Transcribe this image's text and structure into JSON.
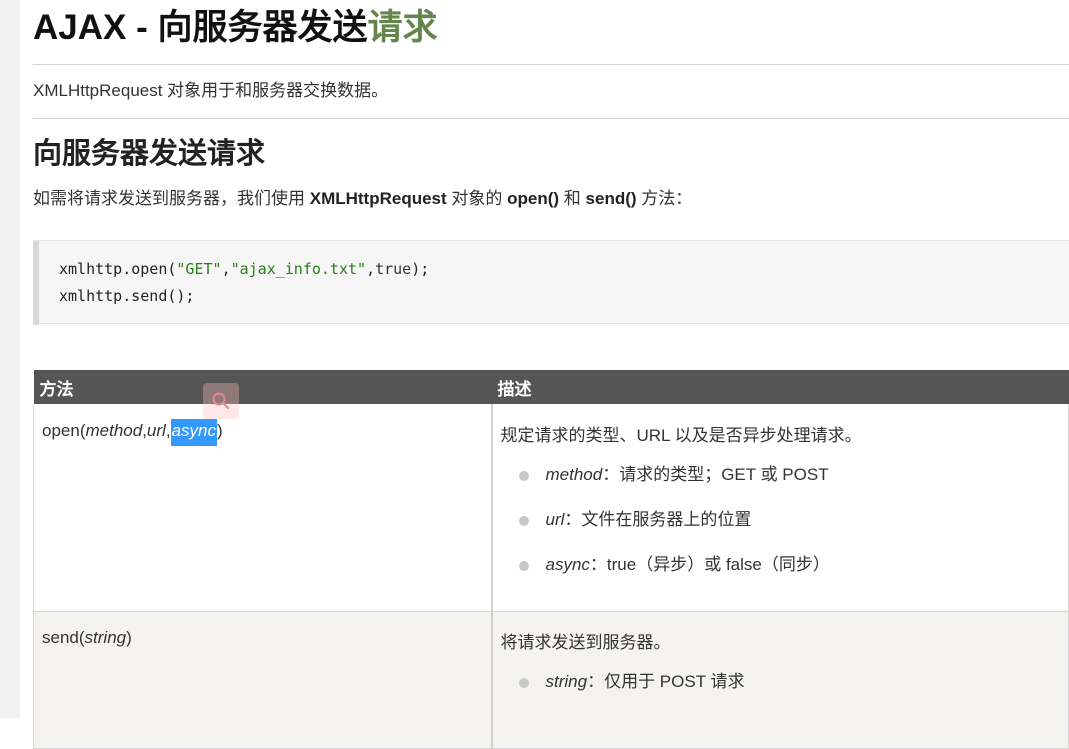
{
  "page": {
    "title_main": "AJAX - 向服务器发送",
    "title_accent": "请求",
    "intro": "XMLHttpRequest 对象用于和服务器交换数据。",
    "section_title": "向服务器发送请求",
    "desc_prefix": "如需将请求发送到服务器，我们使用 ",
    "desc_bold1": "XMLHttpRequest",
    "desc_mid1": " 对象的 ",
    "desc_bold2": "open()",
    "desc_mid2": " 和 ",
    "desc_bold3": "send()",
    "desc_suffix": " 方法："
  },
  "code": {
    "line1_a": "xmlhttp.open(",
    "line1_s1": "\"GET\"",
    "line1_c1": ",",
    "line1_s2": "\"ajax_info.txt\"",
    "line1_c2": ",",
    "line1_kw": "true",
    "line1_end": ");",
    "line2": "xmlhttp.send();"
  },
  "table": {
    "headers": [
      "方法",
      "描述"
    ],
    "rows": [
      {
        "method_prefix": "open(",
        "method_p1": "method",
        "method_sep1": ",",
        "method_p2": "url",
        "method_sep2": ",",
        "method_p3_selected": "async",
        "method_suffix": ")",
        "description": "规定请求的类型、URL 以及是否异步处理请求。",
        "params": [
          {
            "name": "method",
            "text": "：请求的类型；GET 或 POST"
          },
          {
            "name": "url",
            "text": "：文件在服务器上的位置"
          },
          {
            "name": "async",
            "text": "：true（异步）或 false（同步）"
          }
        ]
      },
      {
        "method_prefix": "send(",
        "method_p1": "string",
        "method_suffix": ")",
        "description": "将请求发送到服务器。",
        "params": [
          {
            "name": "string",
            "text": "：仅用于 POST 请求"
          }
        ]
      }
    ]
  },
  "colors": {
    "accent": "#64854c",
    "header_bg": "#555555",
    "selection": "#3399ff",
    "string": "#2a7d18"
  },
  "icons": [
    "search-icon",
    "bullet-dot-icon"
  ]
}
